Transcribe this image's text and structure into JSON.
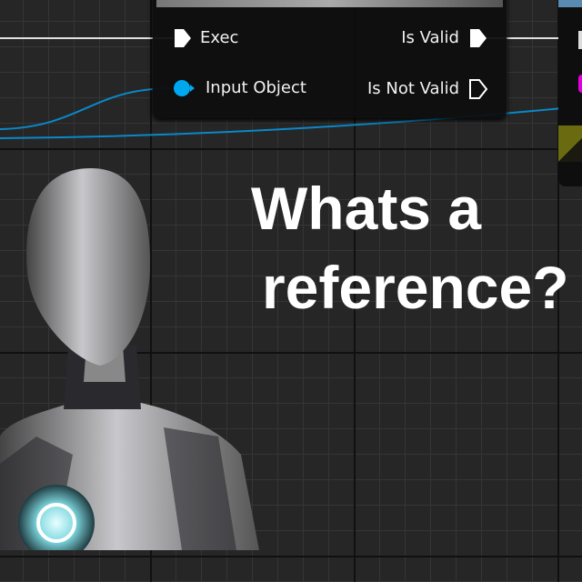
{
  "node": {
    "pins_in": [
      "Exec",
      "Input Object"
    ],
    "pins_out": [
      "Is Valid",
      "Is Not Valid"
    ]
  },
  "overlay": {
    "line1": "Whats a",
    "line2": "reference?"
  },
  "colors": {
    "exec": "#ffffff",
    "object_pin": "#00a8f0",
    "wire_blue": "#0a88c8"
  }
}
